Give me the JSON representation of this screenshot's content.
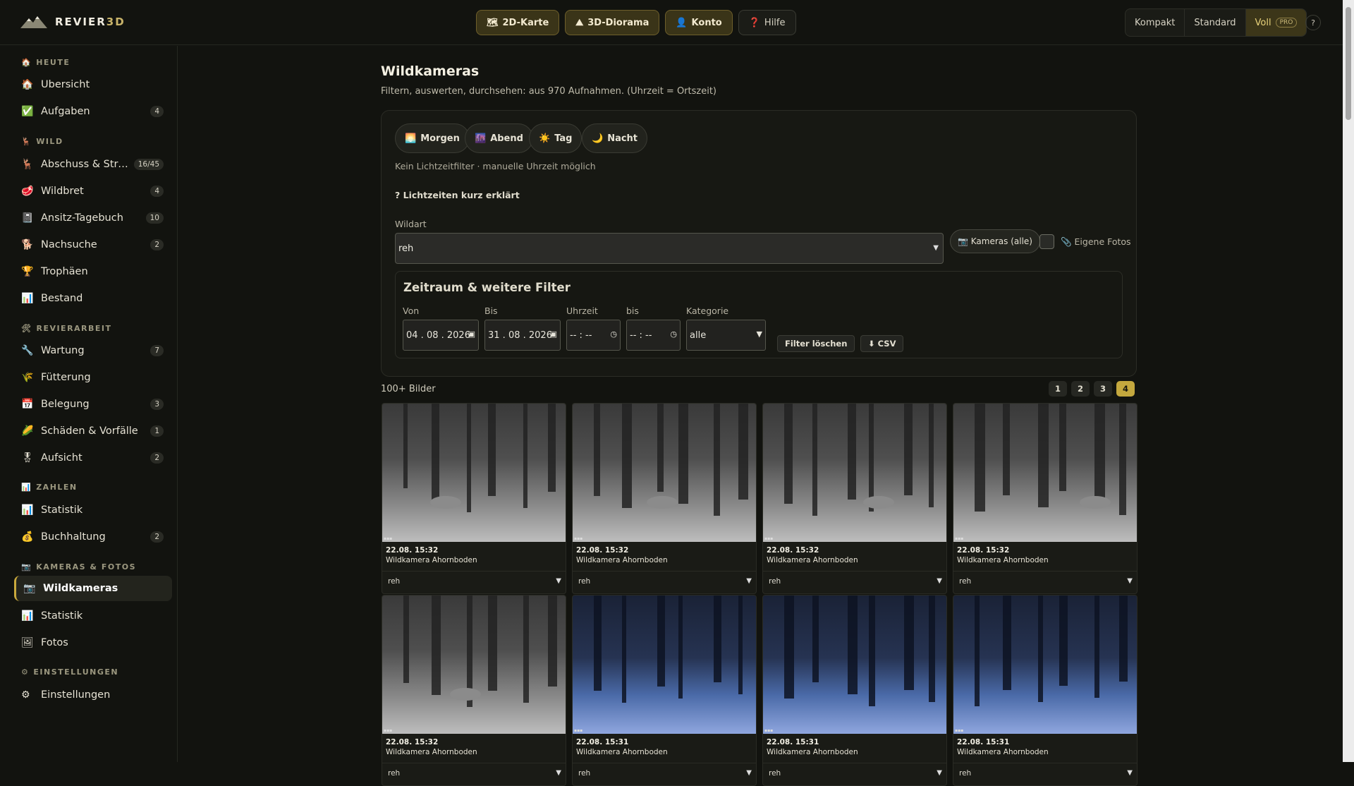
{
  "app": {
    "logo_a": "REVIER",
    "logo_b": "3D"
  },
  "topnav": [
    {
      "icon": "🗺",
      "label": "2D-Karte"
    },
    {
      "icon": "⛰",
      "label": "3D-Diorama"
    },
    {
      "icon": "👤",
      "label": "Konto"
    },
    {
      "icon": "❓",
      "label": "Hilfe"
    }
  ],
  "view": {
    "kompakt": "Kompakt",
    "standard": "Standard",
    "voll": "Voll",
    "pro": "PRO",
    "help": "?"
  },
  "sidebar": {
    "sections": [
      {
        "icon": "🏠",
        "label": "HEUTE"
      },
      {
        "icon": "🦌",
        "label": "WILD"
      },
      {
        "icon": "🛠",
        "label": "REVIERARBEIT"
      },
      {
        "icon": "📊",
        "label": "ZAHLEN"
      },
      {
        "icon": "📷",
        "label": "KAMERAS & FOTOS"
      },
      {
        "icon": "⚙",
        "label": "EINSTELLUNGEN"
      }
    ],
    "items": [
      {
        "icon": "🏠",
        "label": "Übersicht",
        "badge": ""
      },
      {
        "icon": "✅",
        "label": "Aufgaben",
        "badge": "4"
      },
      {
        "icon": "🦌",
        "label": "Abschuss & Strecke",
        "badge": "16/45"
      },
      {
        "icon": "🥩",
        "label": "Wildbret",
        "badge": "4"
      },
      {
        "icon": "📓",
        "label": "Ansitz-Tagebuch",
        "badge": "10"
      },
      {
        "icon": "🐕",
        "label": "Nachsuche",
        "badge": "2"
      },
      {
        "icon": "🏆",
        "label": "Trophäen",
        "badge": ""
      },
      {
        "icon": "📊",
        "label": "Bestand",
        "badge": ""
      },
      {
        "icon": "🔧",
        "label": "Wartung",
        "badge": "7"
      },
      {
        "icon": "🌾",
        "label": "Fütterung",
        "badge": ""
      },
      {
        "icon": "📅",
        "label": "Belegung",
        "badge": "3"
      },
      {
        "icon": "🌽",
        "label": "Schäden & Vorfälle",
        "badge": "1"
      },
      {
        "icon": "🎖",
        "label": "Aufsicht",
        "badge": "2"
      },
      {
        "icon": "📊",
        "label": "Statistik",
        "badge": ""
      },
      {
        "icon": "💰",
        "label": "Buchhaltung",
        "badge": "2"
      },
      {
        "icon": "📷",
        "label": "Wildkameras",
        "badge": ""
      },
      {
        "icon": "📊",
        "label": "Statistik",
        "badge": ""
      },
      {
        "icon": "🖼",
        "label": "Fotos",
        "badge": ""
      },
      {
        "icon": "⚙",
        "label": "Einstellungen",
        "badge": ""
      }
    ]
  },
  "page": {
    "title": "Wildkameras",
    "subtitle": "Filtern, auswerten, durchsehen: aus 970 Aufnahmen. (Uhrzeit = Ortszeit)"
  },
  "light": {
    "chips": [
      {
        "icon": "🌅",
        "label": "Morgen"
      },
      {
        "icon": "🌆",
        "label": "Abend"
      },
      {
        "icon": "☀️",
        "label": "Tag"
      },
      {
        "icon": "🌙",
        "label": "Nacht"
      }
    ],
    "note": "Kein Lichtzeitfilter · manuelle Uhrzeit möglich",
    "explain": "? Lichtzeiten kurz erklärt"
  },
  "filter": {
    "wildart_label": "Wildart",
    "wildart_value": "reh",
    "kameras": "📷 Kameras (alle)",
    "eigene": "📎 Eigene Fotos",
    "section_title": "Zeitraum & weitere Filter",
    "von_label": "Von",
    "von": "04 . 08 . 2026",
    "bis_label": "Bis",
    "bis": "31 . 08 . 2026",
    "uhrzeit_label": "Uhrzeit",
    "uhrzeit": "-- : --",
    "bis2_label": "bis",
    "bis2": "-- : --",
    "kategorie_label": "Kategorie",
    "kategorie": "alle",
    "clear": "Filter löschen",
    "csv": "⬇ CSV"
  },
  "results": {
    "count": "100+ Bilder",
    "pages": [
      "1",
      "2",
      "3",
      "4"
    ],
    "current_page": "4"
  },
  "photos": [
    {
      "date": "22.08. 15:32",
      "camera": "Wildkamera Ahornboden",
      "species": "reh",
      "tone": "gray"
    },
    {
      "date": "22.08. 15:32",
      "camera": "Wildkamera Ahornboden",
      "species": "reh",
      "tone": "gray"
    },
    {
      "date": "22.08. 15:32",
      "camera": "Wildkamera Ahornboden",
      "species": "reh",
      "tone": "gray"
    },
    {
      "date": "22.08. 15:32",
      "camera": "Wildkamera Ahornboden",
      "species": "reh",
      "tone": "gray"
    },
    {
      "date": "22.08. 15:32",
      "camera": "Wildkamera Ahornboden",
      "species": "reh",
      "tone": "gray"
    },
    {
      "date": "22.08. 15:31",
      "camera": "Wildkamera Ahornboden",
      "species": "reh",
      "tone": "blue"
    },
    {
      "date": "22.08. 15:31",
      "camera": "Wildkamera Ahornboden",
      "species": "reh",
      "tone": "blue"
    },
    {
      "date": "22.08. 15:31",
      "camera": "Wildkamera Ahornboden",
      "species": "reh",
      "tone": "blue"
    }
  ]
}
